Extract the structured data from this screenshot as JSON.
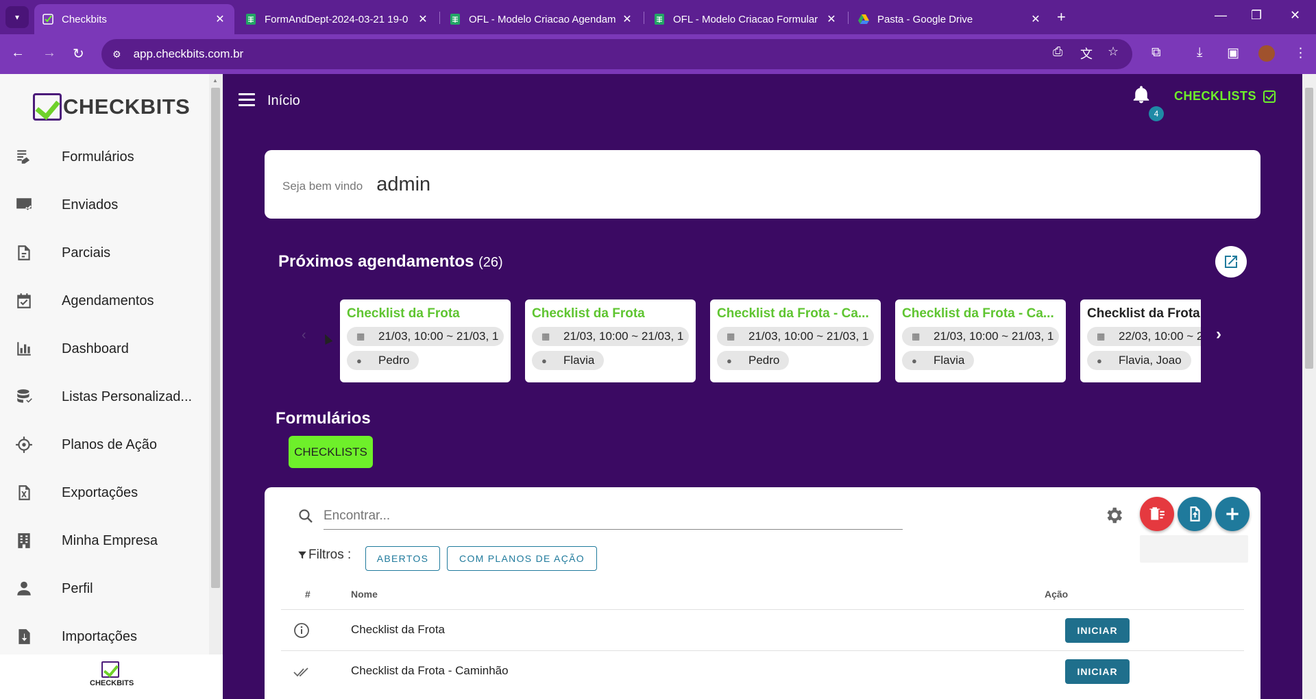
{
  "browser": {
    "tabs": [
      {
        "title": "Checkbits",
        "active": true
      },
      {
        "title": "FormAndDept-2024-03-21 19-0"
      },
      {
        "title": "OFL - Modelo Criacao Agendam"
      },
      {
        "title": "OFL - Modelo Criacao Formular"
      },
      {
        "title": "Pasta - Google Drive"
      }
    ],
    "url": "app.checkbits.com.br"
  },
  "sidebar": {
    "logo_text": "CHECKBITS",
    "items": [
      {
        "label": "Formulários",
        "icon": "form-edit-icon"
      },
      {
        "label": "Enviados",
        "icon": "sent-list-icon"
      },
      {
        "label": "Parciais",
        "icon": "partial-doc-icon"
      },
      {
        "label": "Agendamentos",
        "icon": "calendar-check-icon"
      },
      {
        "label": "Dashboard",
        "icon": "bar-chart-icon"
      },
      {
        "label": "Listas Personalizad...",
        "icon": "database-icon"
      },
      {
        "label": "Planos de Ação",
        "icon": "crosshair-icon"
      },
      {
        "label": "Exportações",
        "icon": "excel-export-icon"
      },
      {
        "label": "Minha Empresa",
        "icon": "building-icon"
      },
      {
        "label": "Perfil",
        "icon": "person-icon"
      },
      {
        "label": "Importações",
        "icon": "import-doc-icon"
      }
    ],
    "footer_logo_text": "CHECKBITS"
  },
  "header": {
    "title": "Início",
    "notifications": "4",
    "checklists_link": "CHECKLISTS"
  },
  "welcome": {
    "label": "Seja bem vindo",
    "user": "admin"
  },
  "schedules": {
    "title": "Próximos agendamentos",
    "count": "(26)",
    "cards": [
      {
        "title": "Checklist da Frota",
        "time": "21/03, 10:00 ~ 21/03, 1",
        "person": "Pedro",
        "highlight": true
      },
      {
        "title": "Checklist da Frota",
        "time": "21/03, 10:00 ~ 21/03, 1",
        "person": "Flavia",
        "highlight": true
      },
      {
        "title": "Checklist da Frota - Ca...",
        "time": "21/03, 10:00 ~ 21/03, 1",
        "person": "Pedro",
        "highlight": true
      },
      {
        "title": "Checklist da Frota - Ca...",
        "time": "21/03, 10:00 ~ 21/03, 1",
        "person": "Flavia",
        "highlight": true
      },
      {
        "title": "Checklist da Frota",
        "time": "22/03, 10:00 ~ 2",
        "person": "Flavia, Joao",
        "highlight": false
      }
    ]
  },
  "forms": {
    "title": "Formulários",
    "category_button": "CHECKLISTS",
    "search_placeholder": "Encontrar...",
    "filters_label": "Filtros :",
    "filter_buttons": [
      "ABERTOS",
      "COM PLANOS DE AÇÃO"
    ],
    "columns": [
      "#",
      "Nome",
      "Ação"
    ],
    "rows": [
      {
        "icon": "info-icon",
        "name": "Checklist da Frota",
        "action": "INICIAR"
      },
      {
        "icon": "double-check-icon",
        "name": "Checklist da Frota - Caminhão",
        "action": "INICIAR"
      }
    ]
  },
  "colors": {
    "brand_purple": "#3b0a63",
    "accent_green": "#6ef02a",
    "card_title_green": "#5fc531",
    "action_teal": "#1f6f8c",
    "delete_red": "#e5393f"
  }
}
